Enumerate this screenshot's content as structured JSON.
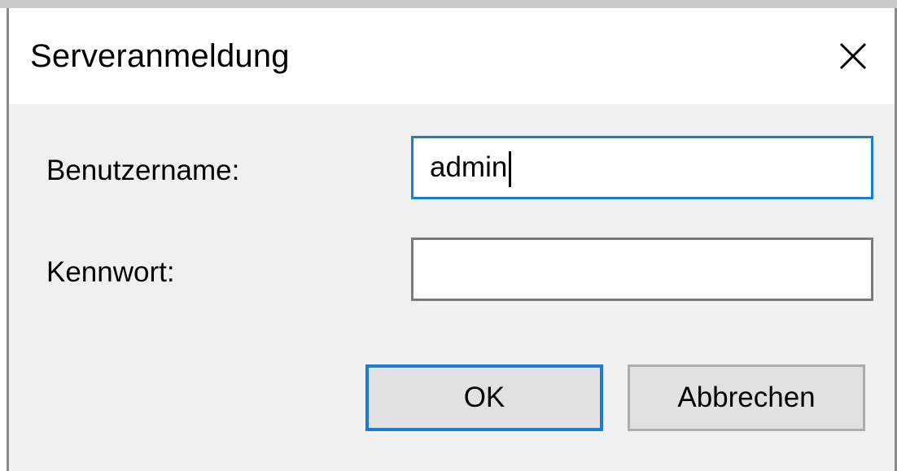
{
  "dialog": {
    "title": "Serveranmeldung",
    "close_icon": "close-icon"
  },
  "form": {
    "username_label": "Benutzername:",
    "username_value": "admin",
    "password_label": "Kennwort:",
    "password_value": ""
  },
  "buttons": {
    "ok_label": "OK",
    "cancel_label": "Abbrechen"
  },
  "colors": {
    "focus_accent": "#1e7bd4",
    "dialog_background": "#f0f0f0",
    "titlebar_background": "#ffffff"
  }
}
